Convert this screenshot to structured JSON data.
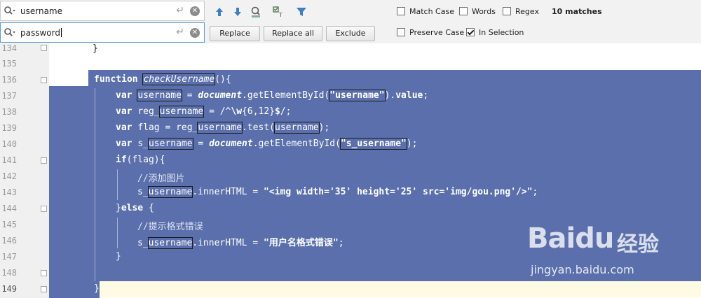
{
  "find": {
    "search_value": "username",
    "replace_value": "password",
    "replace_label": "Replace",
    "replace_all_label": "Replace all",
    "exclude_label": "Exclude",
    "options": {
      "match_case": {
        "label": "Match Case",
        "checked": false
      },
      "words": {
        "label": "Words",
        "checked": false
      },
      "regex": {
        "label": "Regex",
        "checked": false
      },
      "preserve_case": {
        "label": "Preserve Case",
        "checked": false
      },
      "in_selection": {
        "label": "In Selection",
        "checked": true
      }
    },
    "matches": "10 matches",
    "icons": [
      "magnifier-history-icon",
      "enter-icon",
      "clear-icon",
      "previous-occurrence-icon",
      "next-occurrence-icon",
      "find-all-icon",
      "select-all-occurrences-icon",
      "filter-icon"
    ]
  },
  "editor": {
    "line_numbers": [
      "134",
      "135",
      "136",
      "137",
      "138",
      "139",
      "140",
      "141",
      "142",
      "143",
      "144",
      "145",
      "146",
      "147",
      "148",
      "149"
    ],
    "lines": {
      "l134": "}",
      "l136a": "function ",
      "l136b": "checkUsername",
      "l136c": "(){",
      "l137a": "var ",
      "l137b": "username",
      "l137c": " = ",
      "l137d": "document",
      "l137e": ".getElementById(",
      "l137f": "\"username\"",
      "l137g": ").",
      "l137h": "value",
      "l137i": ";",
      "l138a": "var ",
      "l138b": "reg_",
      "l138c": "username",
      "l138d": " = /^",
      "l138e": "\\w",
      "l138f": "{6,12}",
      "l138g": "$",
      "l138h": "/;",
      "l139a": "var ",
      "l139b": "flag = reg_",
      "l139c": "username",
      "l139d": ".test(",
      "l139e": "username",
      "l139f": ");",
      "l140a": "var ",
      "l140b": "s_",
      "l140c": "username",
      "l140d": " = ",
      "l140e": "document",
      "l140f": ".getElementById(",
      "l140g": "\"s_username\"",
      "l140h": ");",
      "l141a": "if",
      "l141b": "(flag){",
      "l142": "//添加图片",
      "l143a": "s_",
      "l143b": "username",
      "l143c": ".innerHTML = ",
      "l143d": "\"<img width='35' height='25' src='img/gou.png'/>\"",
      "l143e": ";",
      "l144a": "}",
      "l144b": "else",
      "l144c": " {",
      "l145": "//提示格式错误",
      "l146a": "s_",
      "l146b": "username",
      "l146c": ".innerHTML = ",
      "l146d": "\"用户名格式错误\"",
      "l146e": ";",
      "l147": "}",
      "l149": "}"
    },
    "colors": {
      "selection": "#5a6fab",
      "current_line": "#fffae3",
      "gutter": "#f0f0f0"
    }
  },
  "watermark": {
    "brand": "Baidu",
    "brand2": "经验",
    "url": "jingyan.baidu.com"
  }
}
